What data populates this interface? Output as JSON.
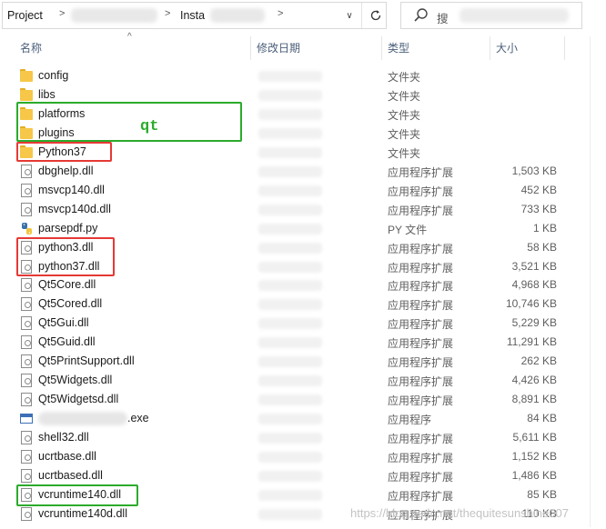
{
  "address_bar": {
    "root_label": "Project",
    "separator": ">",
    "mid_label": "Insta",
    "dropdown_glyph": "∨",
    "refresh_icon": "refresh-icon"
  },
  "search": {
    "label": "搜"
  },
  "header": {
    "name": "名称",
    "date": "修改日期",
    "type": "类型",
    "size": "大小",
    "sort_indicator": "^"
  },
  "files": [
    {
      "name": "config",
      "type": "文件夹",
      "size": "",
      "icon": "folder-icon"
    },
    {
      "name": "libs",
      "type": "文件夹",
      "size": "",
      "icon": "folder-icon"
    },
    {
      "name": "platforms",
      "type": "文件夹",
      "size": "",
      "icon": "folder-icon"
    },
    {
      "name": "plugins",
      "type": "文件夹",
      "size": "",
      "icon": "folder-icon"
    },
    {
      "name": "Python37",
      "type": "文件夹",
      "size": "",
      "icon": "folder-icon"
    },
    {
      "name": "dbghelp.dll",
      "type": "应用程序扩展",
      "size": "1,503 KB",
      "icon": "dll-file-icon"
    },
    {
      "name": "msvcp140.dll",
      "type": "应用程序扩展",
      "size": "452 KB",
      "icon": "dll-file-icon"
    },
    {
      "name": "msvcp140d.dll",
      "type": "应用程序扩展",
      "size": "733 KB",
      "icon": "dll-file-icon"
    },
    {
      "name": "parsepdf.py",
      "type": "PY 文件",
      "size": "1 KB",
      "icon": "python-file-icon"
    },
    {
      "name": "python3.dll",
      "type": "应用程序扩展",
      "size": "58 KB",
      "icon": "dll-file-icon"
    },
    {
      "name": "python37.dll",
      "type": "应用程序扩展",
      "size": "3,521 KB",
      "icon": "dll-file-icon"
    },
    {
      "name": "Qt5Core.dll",
      "type": "应用程序扩展",
      "size": "4,968 KB",
      "icon": "dll-file-icon"
    },
    {
      "name": "Qt5Cored.dll",
      "type": "应用程序扩展",
      "size": "10,746 KB",
      "icon": "dll-file-icon"
    },
    {
      "name": "Qt5Gui.dll",
      "type": "应用程序扩展",
      "size": "5,229 KB",
      "icon": "dll-file-icon"
    },
    {
      "name": "Qt5Guid.dll",
      "type": "应用程序扩展",
      "size": "11,291 KB",
      "icon": "dll-file-icon"
    },
    {
      "name": "Qt5PrintSupport.dll",
      "type": "应用程序扩展",
      "size": "262 KB",
      "icon": "dll-file-icon"
    },
    {
      "name": "Qt5Widgets.dll",
      "type": "应用程序扩展",
      "size": "4,426 KB",
      "icon": "dll-file-icon"
    },
    {
      "name": "Qt5Widgetsd.dll",
      "type": "应用程序扩展",
      "size": "8,891 KB",
      "icon": "dll-file-icon"
    },
    {
      "name": ".exe",
      "type": "应用程序",
      "size": "84 KB",
      "icon": "exe-file-icon"
    },
    {
      "name": "shell32.dll",
      "type": "应用程序扩展",
      "size": "5,611 KB",
      "icon": "dll-file-icon"
    },
    {
      "name": "ucrtbase.dll",
      "type": "应用程序扩展",
      "size": "1,152 KB",
      "icon": "dll-file-icon"
    },
    {
      "name": "ucrtbased.dll",
      "type": "应用程序扩展",
      "size": "1,486 KB",
      "icon": "dll-file-icon"
    },
    {
      "name": "vcruntime140.dll",
      "type": "应用程序扩展",
      "size": "85 KB",
      "icon": "dll-file-icon"
    },
    {
      "name": "vcruntime140d.dll",
      "type": "应用程序扩展",
      "size": "110 KB",
      "icon": "dll-file-icon"
    }
  ],
  "annotations": {
    "qt_label": "qt",
    "red_color": "#e53935",
    "green_color": "#2bab2b"
  },
  "watermark": "https://blog.csdn.net/thequitesunshine007"
}
